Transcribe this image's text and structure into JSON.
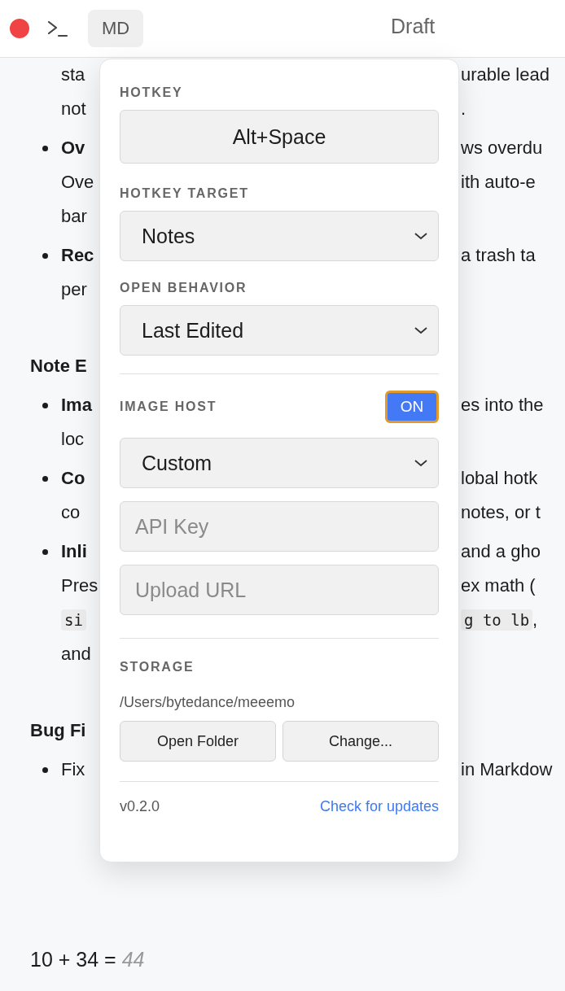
{
  "toolbar": {
    "mode_button": "MD",
    "title": "Draft"
  },
  "document": {
    "lines": [
      {
        "kind": "text",
        "left": [
          {
            "kind": "plain",
            "text": "sta"
          }
        ],
        "right": [
          {
            "kind": "plain",
            "text": "urable lead"
          }
        ]
      },
      {
        "kind": "text",
        "left": [
          {
            "kind": "plain",
            "text": "not"
          }
        ],
        "right": [
          {
            "kind": "plain",
            "text": "."
          }
        ]
      },
      {
        "kind": "bullet",
        "left": [
          {
            "kind": "bold",
            "text": "Ov"
          }
        ],
        "right": [
          {
            "kind": "plain",
            "text": "ws overdu"
          }
        ]
      },
      {
        "kind": "text",
        "left": [
          {
            "kind": "plain",
            "text": "Ove"
          }
        ],
        "right": [
          {
            "kind": "plain",
            "text": "ith auto-e"
          }
        ]
      },
      {
        "kind": "text",
        "left": [
          {
            "kind": "plain",
            "text": "bar"
          }
        ]
      },
      {
        "kind": "bullet",
        "left": [
          {
            "kind": "bold",
            "text": "Rec"
          }
        ],
        "right": [
          {
            "kind": "plain",
            "text": "a trash ta"
          }
        ]
      },
      {
        "kind": "text",
        "left": [
          {
            "kind": "plain",
            "text": "per"
          }
        ]
      },
      {
        "kind": "heading",
        "left": [
          {
            "kind": "bold",
            "text": "Note E"
          }
        ]
      },
      {
        "kind": "bullet",
        "left": [
          {
            "kind": "bold",
            "text": "Ima"
          }
        ],
        "right": [
          {
            "kind": "plain",
            "text": "es into the"
          }
        ]
      },
      {
        "kind": "text",
        "left": [
          {
            "kind": "plain",
            "text": "loc"
          }
        ]
      },
      {
        "kind": "bullet",
        "left": [
          {
            "kind": "bold",
            "text": "Co"
          }
        ],
        "right": [
          {
            "kind": "plain",
            "text": "lobal hotk"
          }
        ]
      },
      {
        "kind": "text",
        "left": [
          {
            "kind": "plain",
            "text": "co"
          }
        ],
        "right": [
          {
            "kind": "plain",
            "text": "notes, or t"
          }
        ]
      },
      {
        "kind": "bullet",
        "left": [
          {
            "kind": "bold",
            "text": "Inli"
          }
        ],
        "right": [
          {
            "kind": "plain",
            "text": "and a gho"
          }
        ]
      },
      {
        "kind": "text",
        "left": [
          {
            "kind": "plain",
            "text": "Pres"
          }
        ],
        "right": [
          {
            "kind": "plain",
            "text": "ex math ("
          }
        ]
      },
      {
        "kind": "text",
        "left": [
          {
            "kind": "code",
            "text": "si"
          }
        ],
        "right": [
          {
            "kind": "code",
            "text": "g to lb"
          },
          {
            "kind": "plain",
            "text": ","
          }
        ]
      },
      {
        "kind": "text",
        "left": [
          {
            "kind": "plain",
            "text": "and"
          }
        ]
      },
      {
        "kind": "heading",
        "left": [
          {
            "kind": "bold",
            "text": "Bug Fi"
          }
        ]
      },
      {
        "kind": "bullet",
        "left": [
          {
            "kind": "plain",
            "text": "Fix"
          }
        ],
        "right": [
          {
            "kind": "plain",
            "text": "in Markdow"
          }
        ]
      }
    ],
    "calculation": {
      "expression": "10 + 34 =",
      "result": "44"
    }
  },
  "settings": {
    "hotkey": {
      "label": "HOTKEY",
      "value": "Alt+Space"
    },
    "hotkey_target": {
      "label": "HOTKEY TARGET",
      "value": "Notes"
    },
    "open_behavior": {
      "label": "OPEN BEHAVIOR",
      "value": "Last Edited"
    },
    "image_host": {
      "label": "IMAGE HOST",
      "toggle": {
        "label": "ON",
        "on": true,
        "focused": true
      },
      "provider": "Custom",
      "fields": [
        {
          "placeholder": "API Key"
        },
        {
          "placeholder": "Upload URL"
        }
      ]
    },
    "storage": {
      "label": "STORAGE",
      "path": "/Users/bytedance/meeemo",
      "buttons": [
        "Open Folder",
        "Change..."
      ]
    },
    "footer": {
      "version": "v0.2.0",
      "link": "Check for updates"
    }
  }
}
